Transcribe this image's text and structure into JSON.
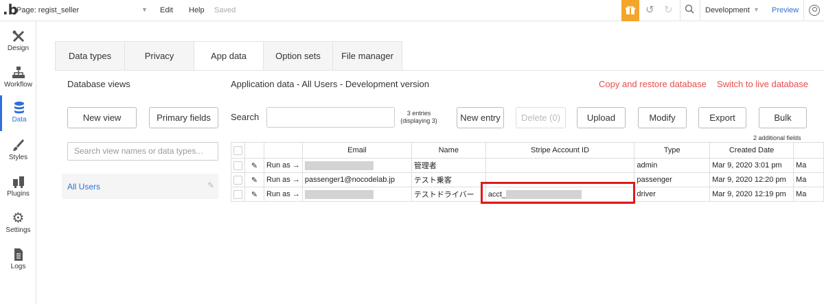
{
  "topbar": {
    "logo": ".b",
    "page": "Page: regist_seller",
    "menu": [
      "Edit",
      "Help"
    ],
    "saved": "Saved",
    "environment": "Development",
    "preview": "Preview",
    "icons": [
      "gift-icon",
      "undo-icon",
      "redo-icon",
      "search-icon",
      "user-icon"
    ]
  },
  "sidebar": {
    "items": [
      {
        "label": "Design",
        "icon": "design-icon"
      },
      {
        "label": "Workflow",
        "icon": "workflow-icon"
      },
      {
        "label": "Data",
        "icon": "database-icon",
        "active": true
      },
      {
        "label": "Styles",
        "icon": "brush-icon"
      },
      {
        "label": "Plugins",
        "icon": "plug-icon"
      },
      {
        "label": "Settings",
        "icon": "gear-icon"
      },
      {
        "label": "Logs",
        "icon": "document-icon"
      }
    ]
  },
  "tabs": [
    "Data types",
    "Privacy",
    "App data",
    "Option sets",
    "File manager"
  ],
  "active_tab": "App data",
  "left": {
    "title": "Database views",
    "new_view": "New view",
    "primary_fields": "Primary fields",
    "search_placeholder": "Search view names or data types...",
    "views": [
      "All Users"
    ]
  },
  "main": {
    "title": "Application data - All Users - Development version",
    "copy_restore": "Copy and restore database",
    "switch_live": "Switch to live database",
    "search_label": "Search",
    "entries_line1": "3 entries",
    "entries_line2": "(displaying 3)",
    "buttons": {
      "new_entry": "New entry",
      "delete": "Delete (0)",
      "upload": "Upload",
      "modify": "Modify",
      "export": "Export",
      "bulk": "Bulk"
    },
    "additional_fields": "2 additional fields"
  },
  "table": {
    "columns": [
      "Email",
      "Name",
      "Stripe Account ID",
      "Type",
      "Created Date"
    ],
    "run_as": "Run as →",
    "rows": [
      {
        "email": "",
        "email_redacted": true,
        "name": "管理者",
        "stripe": "",
        "type": "admin",
        "created": "Mar 9, 2020 3:01 pm",
        "extra": "Ma"
      },
      {
        "email": "passenger1@nocodelab.jp",
        "email_redacted": false,
        "name": "テスト乗客",
        "stripe": "",
        "type": "passenger",
        "created": "Mar 9, 2020 12:20 pm",
        "extra": "Ma"
      },
      {
        "email": "",
        "email_redacted": true,
        "name": "テストドライバー",
        "stripe": "acct_",
        "type": "driver",
        "created": "Mar 9, 2020 12:19 pm",
        "extra": "Ma"
      }
    ]
  },
  "colors": {
    "accent": "#2f6fdb",
    "danger": "#e84b4b",
    "highlight": "#e0181b",
    "gift": "#f4a52a"
  }
}
